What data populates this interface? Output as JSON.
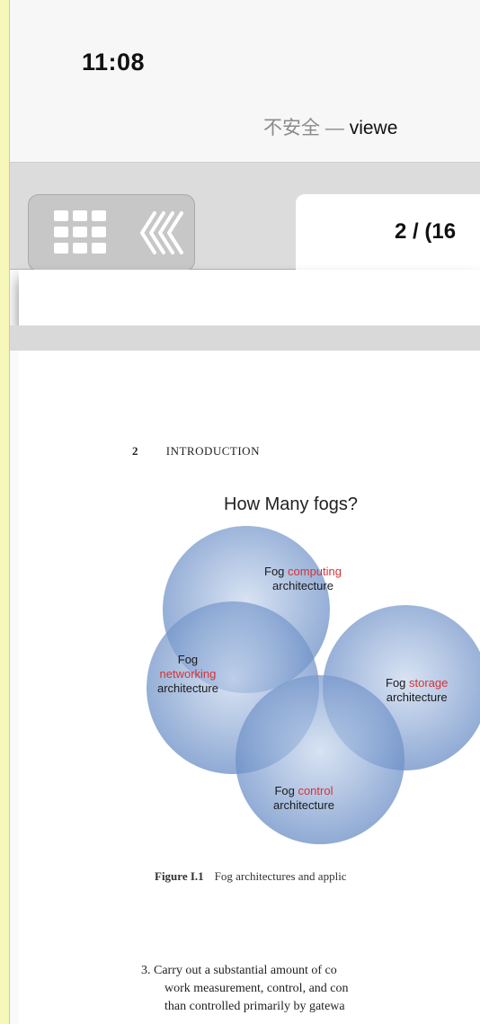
{
  "status_bar": {
    "time": "11:08"
  },
  "url_bar": {
    "security_label": "不安全 —",
    "host_partial": "viewe"
  },
  "toolbar": {
    "page_indicator": "2 / (16"
  },
  "page": {
    "running_head_number": "2",
    "running_head_section": "INTRODUCTION",
    "figure_title": "How Many fogs?",
    "venn": {
      "top": {
        "line1_a": "Fog ",
        "line1_b": "computing",
        "line2": "architecture"
      },
      "left": {
        "line1": "Fog",
        "line2": "networking",
        "line3": "architecture"
      },
      "right": {
        "line1_a": "Fog ",
        "line1_b": "storage",
        "line2": "architecture"
      },
      "bottom": {
        "line1_a": "Fog ",
        "line1_b": "control",
        "line2": "architecture"
      }
    },
    "caption_label": "Figure I.1",
    "caption_text": "Fog architectures and applic",
    "body_lines": [
      "3. Carry out a substantial amount of co",
      "work measurement, control, and con",
      "than controlled primarily by gatewa"
    ]
  },
  "colors": {
    "accent_red": "#d63238",
    "circle_blue": "#5b82c0",
    "outer_border": "#f6f7b8"
  }
}
